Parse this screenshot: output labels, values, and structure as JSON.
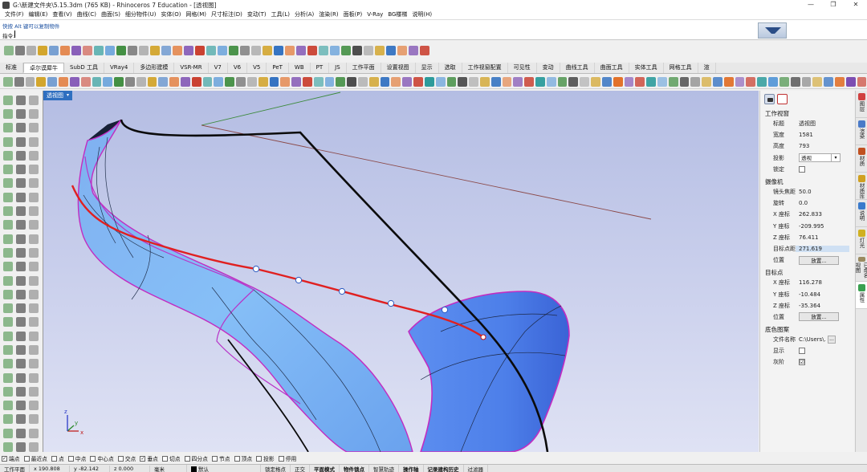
{
  "window": {
    "title": "G:\\新建文件夹\\5.15.3dm (765 KB) - Rhinoceros 7 Education - [透视图]",
    "controls": [
      "—",
      "❐",
      "✕"
    ]
  },
  "menu": [
    "文件(F)",
    "编辑(E)",
    "查看(V)",
    "曲线(C)",
    "曲面(S)",
    "细分物件(U)",
    "实体(O)",
    "网格(M)",
    "尺寸标注(D)",
    "变动(T)",
    "工具(L)",
    "分析(A)",
    "渲染(R)",
    "面板(P)",
    "V-Ray",
    "BG楼梯",
    "说明(H)"
  ],
  "command": {
    "history": "快按 Alt 键可以复制物件",
    "prompt": "指令:"
  },
  "tabs": [
    {
      "label": "标准",
      "active": false
    },
    {
      "label": "卓尔谟犀牛",
      "active": true
    },
    {
      "label": "SubD 工具",
      "active": false
    },
    {
      "label": "VRay4",
      "active": false
    },
    {
      "label": "多边形建模",
      "active": false
    },
    {
      "label": "VSR-MR",
      "active": false
    },
    {
      "label": "V7",
      "active": false
    },
    {
      "label": "V6",
      "active": false
    },
    {
      "label": "V5",
      "active": false
    },
    {
      "label": "PeT",
      "active": false
    },
    {
      "label": "WB",
      "active": false
    },
    {
      "label": "PT",
      "active": false
    },
    {
      "label": "JS",
      "active": false
    },
    {
      "label": "工作平面",
      "active": false
    },
    {
      "label": "设置视图",
      "active": false
    },
    {
      "label": "显示",
      "active": false
    },
    {
      "label": "选取",
      "active": false
    },
    {
      "label": "工作视窗配置",
      "active": false
    },
    {
      "label": "可见性",
      "active": false
    },
    {
      "label": "变动",
      "active": false
    },
    {
      "label": "曲线工具",
      "active": false
    },
    {
      "label": "曲面工具",
      "active": false
    },
    {
      "label": "实体工具",
      "active": false
    },
    {
      "label": "网格工具",
      "active": false
    },
    {
      "label": "渲",
      "active": false
    }
  ],
  "viewport": {
    "label": "透视图",
    "dropdown": "▾",
    "axes": {
      "x": "x",
      "y": "y",
      "z": "z"
    }
  },
  "panel": {
    "section_viewport": "工作视窗",
    "title_label": "标题",
    "title_value": "透视图",
    "width_label": "宽度",
    "width_value": "1581",
    "height_label": "高度",
    "height_value": "793",
    "projection_label": "投影",
    "projection_value": "透视",
    "lock_label": "锁定",
    "section_camera": "摄像机",
    "lens_label": "镜头焦距(...",
    "lens_value": "50.0",
    "rotation_label": "旋转",
    "rotation_value": "0.0",
    "cam_x_label": "X 座标",
    "cam_x_value": "262.833",
    "cam_y_label": "Y 座标",
    "cam_y_value": "-209.995",
    "cam_z_label": "Z 座标",
    "cam_z_value": "76.411",
    "target_dist_label": "目标点距离",
    "target_dist_value": "271.619",
    "cam_pos_label": "位置",
    "cam_pos_button": "放置...",
    "section_target": "目标点",
    "tgt_x_label": "X 座标",
    "tgt_x_value": "116.278",
    "tgt_y_label": "Y 座标",
    "tgt_y_value": "-10.484",
    "tgt_z_label": "Z 座标",
    "tgt_z_value": "-35.364",
    "tgt_pos_label": "位置",
    "tgt_pos_button": "放置...",
    "section_bg": "底色图案",
    "filename_label": "文件名称",
    "filename_value": "C:\\Users\\...",
    "filename_browse": "...",
    "show_label": "显示",
    "gray_label": "灰阶",
    "gray_check": "☑"
  },
  "vtabs": [
    {
      "label": "图层",
      "color": "#d04040"
    },
    {
      "label": "渲染",
      "color": "#4a7ac8"
    },
    {
      "label": "材质",
      "color": "#c05020"
    },
    {
      "label": "材质库",
      "color": "#d0a020"
    },
    {
      "label": "说明",
      "color": "#3a7acc"
    },
    {
      "label": "灯光",
      "color": "#d0b020"
    },
    {
      "label": "已命名视图",
      "color": "#9a8a60"
    },
    {
      "label": "属性",
      "color": "#3aa050",
      "active": true
    }
  ],
  "osnaps": [
    {
      "label": "端点",
      "checked": true
    },
    {
      "label": "最近点",
      "checked": false
    },
    {
      "label": "点",
      "checked": false
    },
    {
      "label": "中点",
      "checked": false
    },
    {
      "label": "中心点",
      "checked": false
    },
    {
      "label": "交点",
      "checked": false
    },
    {
      "label": "垂点",
      "checked": true
    },
    {
      "label": "切点",
      "checked": false
    },
    {
      "label": "四分点",
      "checked": false
    },
    {
      "label": "节点",
      "checked": false
    },
    {
      "label": "顶点",
      "checked": false
    },
    {
      "label": "投影",
      "checked": false
    },
    {
      "label": "停用",
      "checked": false
    }
  ],
  "status": {
    "cplane": "工作平面",
    "x": "x 190.808",
    "y": "y -82.142",
    "z": "z 0.000",
    "units": "毫米",
    "layer": "默认",
    "grid_snap": "锁定格点",
    "ortho": "正交",
    "planar": "平面模式",
    "osnap": "物件锁点",
    "smarttrack": "智慧轨迹",
    "gumball": "操作轴",
    "history": "记录建构历史",
    "filter": "过滤器"
  }
}
